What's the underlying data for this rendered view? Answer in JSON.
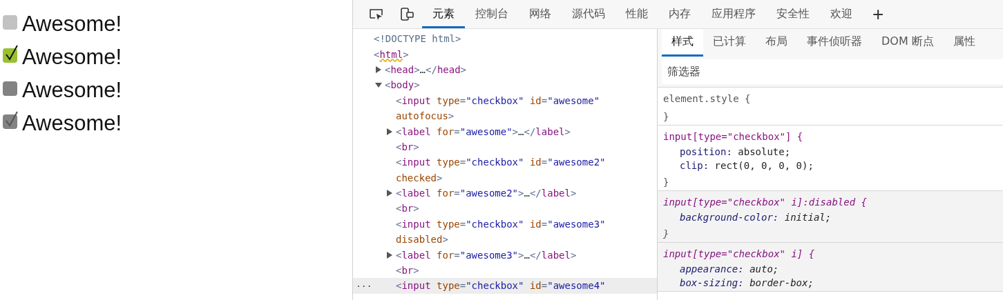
{
  "demo": {
    "items": [
      {
        "label": "Awesome!",
        "checked": false,
        "disabled": false
      },
      {
        "label": "Awesome!",
        "checked": true,
        "disabled": false
      },
      {
        "label": "Awesome!",
        "checked": false,
        "disabled": true
      },
      {
        "label": "Awesome!",
        "checked": true,
        "disabled": true
      }
    ]
  },
  "devtools": {
    "tools": [
      {
        "kind": "inspect"
      },
      {
        "kind": "device"
      }
    ],
    "tabs": [
      {
        "label": "元素",
        "selected": true
      },
      {
        "label": "控制台",
        "selected": false
      },
      {
        "label": "网络",
        "selected": false
      },
      {
        "label": "源代码",
        "selected": false
      },
      {
        "label": "性能",
        "selected": false
      },
      {
        "label": "内存",
        "selected": false
      },
      {
        "label": "应用程序",
        "selected": false
      },
      {
        "label": "安全性",
        "selected": false
      },
      {
        "label": "欢迎",
        "selected": false
      }
    ],
    "add_tab": "+",
    "dom": [
      {
        "line": [
          {
            "kind": "punct",
            "text": "<!DOCTYPE html>"
          }
        ]
      },
      {
        "line": [
          {
            "kind": "punct",
            "text": "<"
          },
          {
            "kind": "tag",
            "text": "html",
            "issue": true
          },
          {
            "kind": "punct",
            "text": ">"
          }
        ],
        "children": [
          {
            "expanded": false,
            "line": [
              {
                "kind": "punct",
                "text": "<"
              },
              {
                "kind": "tag",
                "text": "head"
              },
              {
                "kind": "punct",
                "text": ">"
              },
              {
                "kind": "text",
                "text": "…"
              },
              {
                "kind": "punct",
                "text": "</"
              },
              {
                "kind": "tag",
                "text": "head"
              },
              {
                "kind": "punct",
                "text": ">"
              }
            ]
          },
          {
            "expanded": true,
            "line": [
              {
                "kind": "punct",
                "text": "<"
              },
              {
                "kind": "tag",
                "text": "body"
              },
              {
                "kind": "punct",
                "text": ">"
              }
            ],
            "children": [
              {
                "selected": false,
                "line": [
                  {
                    "kind": "punct",
                    "text": "<"
                  },
                  {
                    "kind": "tag",
                    "text": "input"
                  },
                  {
                    "kind": "attr",
                    "text": " type"
                  },
                  {
                    "kind": "punct",
                    "text": "="
                  },
                  {
                    "kind": "value",
                    "text": "\"checkbox\""
                  },
                  {
                    "kind": "attr",
                    "text": " id"
                  },
                  {
                    "kind": "punct",
                    "text": "="
                  },
                  {
                    "kind": "value",
                    "text": "\"awesome\""
                  }
                ],
                "wrap": [
                  {
                    "kind": "attr",
                    "text": "autofocus"
                  },
                  {
                    "kind": "punct",
                    "text": ">"
                  }
                ]
              },
              {
                "expanded": false,
                "line": [
                  {
                    "kind": "punct",
                    "text": "<"
                  },
                  {
                    "kind": "tag",
                    "text": "label"
                  },
                  {
                    "kind": "attr",
                    "text": " for"
                  },
                  {
                    "kind": "punct",
                    "text": "="
                  },
                  {
                    "kind": "value",
                    "text": "\"awesome\""
                  },
                  {
                    "kind": "punct",
                    "text": ">"
                  },
                  {
                    "kind": "text",
                    "text": "…"
                  },
                  {
                    "kind": "punct",
                    "text": "</"
                  },
                  {
                    "kind": "tag",
                    "text": "label"
                  },
                  {
                    "kind": "punct",
                    "text": ">"
                  }
                ]
              },
              {
                "line": [
                  {
                    "kind": "punct",
                    "text": "<"
                  },
                  {
                    "kind": "tag",
                    "text": "br"
                  },
                  {
                    "kind": "punct",
                    "text": ">"
                  }
                ]
              },
              {
                "selected": false,
                "line": [
                  {
                    "kind": "punct",
                    "text": "<"
                  },
                  {
                    "kind": "tag",
                    "text": "input"
                  },
                  {
                    "kind": "attr",
                    "text": " type"
                  },
                  {
                    "kind": "punct",
                    "text": "="
                  },
                  {
                    "kind": "value",
                    "text": "\"checkbox\""
                  },
                  {
                    "kind": "attr",
                    "text": " id"
                  },
                  {
                    "kind": "punct",
                    "text": "="
                  },
                  {
                    "kind": "value",
                    "text": "\"awesome2\""
                  }
                ],
                "wrap": [
                  {
                    "kind": "attr",
                    "text": "checked"
                  },
                  {
                    "kind": "punct",
                    "text": ">"
                  }
                ]
              },
              {
                "expanded": false,
                "line": [
                  {
                    "kind": "punct",
                    "text": "<"
                  },
                  {
                    "kind": "tag",
                    "text": "label"
                  },
                  {
                    "kind": "attr",
                    "text": " for"
                  },
                  {
                    "kind": "punct",
                    "text": "="
                  },
                  {
                    "kind": "value",
                    "text": "\"awesome2\""
                  },
                  {
                    "kind": "punct",
                    "text": ">"
                  },
                  {
                    "kind": "text",
                    "text": "…"
                  },
                  {
                    "kind": "punct",
                    "text": "</"
                  },
                  {
                    "kind": "tag",
                    "text": "label"
                  },
                  {
                    "kind": "punct",
                    "text": ">"
                  }
                ]
              },
              {
                "line": [
                  {
                    "kind": "punct",
                    "text": "<"
                  },
                  {
                    "kind": "tag",
                    "text": "br"
                  },
                  {
                    "kind": "punct",
                    "text": ">"
                  }
                ]
              },
              {
                "selected": false,
                "line": [
                  {
                    "kind": "punct",
                    "text": "<"
                  },
                  {
                    "kind": "tag",
                    "text": "input"
                  },
                  {
                    "kind": "attr",
                    "text": " type"
                  },
                  {
                    "kind": "punct",
                    "text": "="
                  },
                  {
                    "kind": "value",
                    "text": "\"checkbox\""
                  },
                  {
                    "kind": "attr",
                    "text": " id"
                  },
                  {
                    "kind": "punct",
                    "text": "="
                  },
                  {
                    "kind": "value",
                    "text": "\"awesome3\""
                  }
                ],
                "wrap": [
                  {
                    "kind": "attr",
                    "text": "disabled"
                  },
                  {
                    "kind": "punct",
                    "text": ">"
                  }
                ]
              },
              {
                "expanded": false,
                "line": [
                  {
                    "kind": "punct",
                    "text": "<"
                  },
                  {
                    "kind": "tag",
                    "text": "label"
                  },
                  {
                    "kind": "attr",
                    "text": " for"
                  },
                  {
                    "kind": "punct",
                    "text": "="
                  },
                  {
                    "kind": "value",
                    "text": "\"awesome3\""
                  },
                  {
                    "kind": "punct",
                    "text": ">"
                  },
                  {
                    "kind": "text",
                    "text": "…"
                  },
                  {
                    "kind": "punct",
                    "text": "</"
                  },
                  {
                    "kind": "tag",
                    "text": "label"
                  },
                  {
                    "kind": "punct",
                    "text": ">"
                  }
                ]
              },
              {
                "line": [
                  {
                    "kind": "punct",
                    "text": "<"
                  },
                  {
                    "kind": "tag",
                    "text": "br"
                  },
                  {
                    "kind": "punct",
                    "text": ">"
                  }
                ]
              },
              {
                "selected": true,
                "more": "···",
                "line": [
                  {
                    "kind": "punct",
                    "text": "<"
                  },
                  {
                    "kind": "tag",
                    "text": "input"
                  },
                  {
                    "kind": "attr",
                    "text": " type"
                  },
                  {
                    "kind": "punct",
                    "text": "="
                  },
                  {
                    "kind": "value",
                    "text": "\"checkbox\""
                  },
                  {
                    "kind": "attr",
                    "text": " id"
                  },
                  {
                    "kind": "punct",
                    "text": "="
                  },
                  {
                    "kind": "value",
                    "text": "\"awesome4\""
                  }
                ]
              }
            ]
          }
        ]
      }
    ],
    "styles": {
      "tabs": [
        {
          "label": "样式",
          "selected": true
        },
        {
          "label": "已计算",
          "selected": false
        },
        {
          "label": "布局",
          "selected": false
        },
        {
          "label": "事件侦听器",
          "selected": false
        },
        {
          "label": "DOM 断点",
          "selected": false
        },
        {
          "label": "属性",
          "selected": false
        }
      ],
      "filter": {
        "placeholder": "筛选器"
      },
      "rules": [
        {
          "selector": "element.style {",
          "user_agent": false,
          "close": "}"
        },
        {
          "selector": "input[type=\"checkbox\"] {",
          "user_agent": false,
          "declarations": [
            {
              "property": "position:",
              "value": "absolute;"
            },
            {
              "property": "clip:",
              "value": "rect(0, 0, 0, 0);"
            }
          ],
          "close": "}"
        },
        {
          "selector": "input[type=\"checkbox\" i]:disabled {",
          "user_agent": true,
          "declarations": [
            {
              "property": "background-color:",
              "value": "initial;"
            }
          ],
          "close": "}"
        },
        {
          "selector": "input[type=\"checkbox\" i] {",
          "user_agent": true,
          "declarations": [
            {
              "property": "appearance:",
              "value": "auto;"
            },
            {
              "property": "box-sizing:",
              "value": "border-box;"
            }
          ]
        }
      ]
    }
  }
}
